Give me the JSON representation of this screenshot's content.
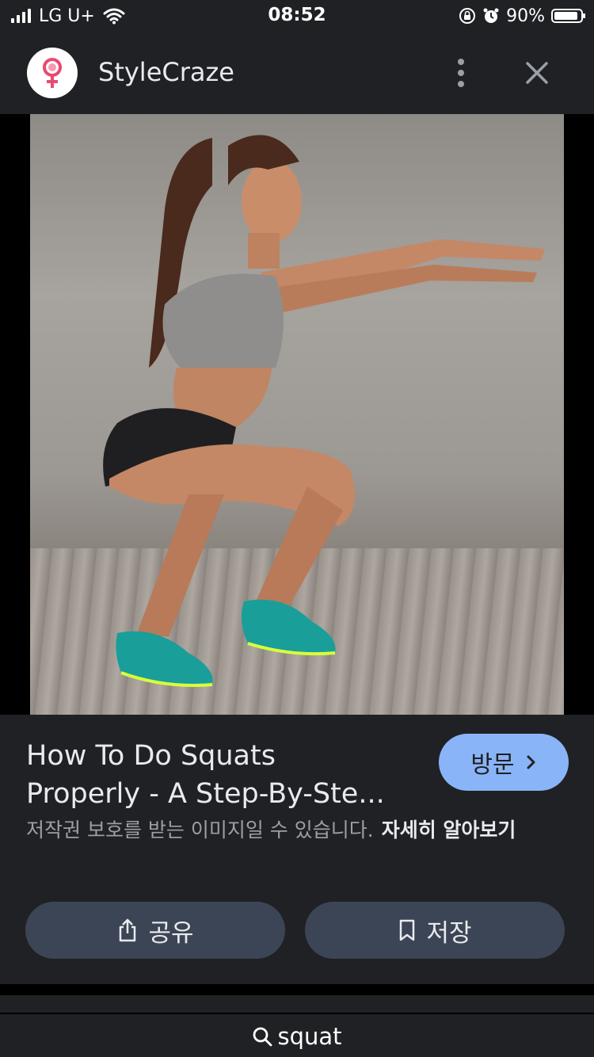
{
  "status_bar": {
    "carrier": "LG U+",
    "time": "08:52",
    "battery_percent": "90%",
    "battery_level": 0.9,
    "icons": [
      "signal-icon",
      "wifi-icon",
      "orientation-lock-icon",
      "alarm-icon",
      "battery-icon"
    ]
  },
  "header": {
    "site_name": "StyleCraze",
    "logo_icon": "female-symbol-icon",
    "logo_color": "#e94a6f",
    "more_icon": "more-vertical-icon",
    "close_icon": "close-icon"
  },
  "image": {
    "lens_icon": "google-lens-icon"
  },
  "info": {
    "title_line1": "How To Do Squats",
    "title_line2": "Properly - A Step-By-Ste...",
    "visit_label": "방문",
    "copyright_text": "저작권 보호를 받는 이미지일 수 있습니다.",
    "learn_more": "자세히 알아보기",
    "share_label": "공유",
    "save_label": "저장",
    "accent_color": "#8ab4f8",
    "pill_color": "#3c4556"
  },
  "bottom": {
    "query": "squat"
  }
}
